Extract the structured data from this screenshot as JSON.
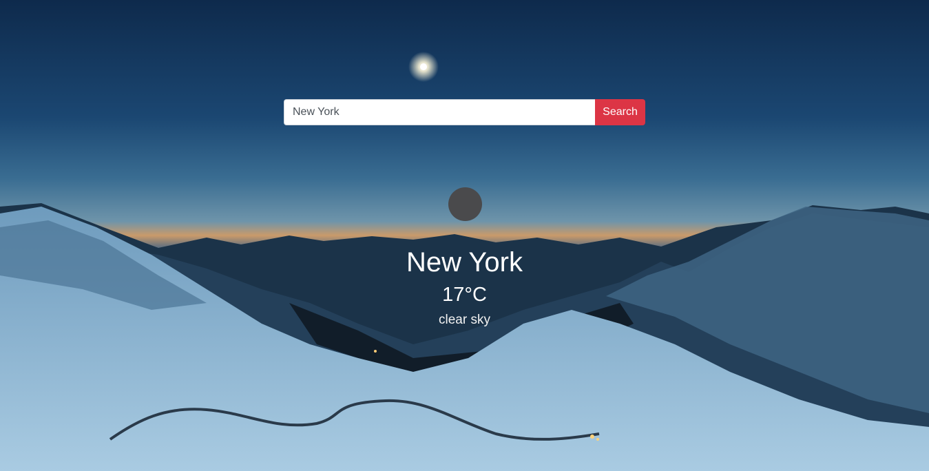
{
  "search": {
    "value": "New York",
    "button_label": "Search"
  },
  "weather": {
    "icon": "weather-condition-icon",
    "city": "New York",
    "temperature": "17°C",
    "description": "clear sky"
  },
  "colors": {
    "search_button": "#dc3545",
    "icon_placeholder": "#4a4a4c",
    "text": "#ffffff"
  }
}
